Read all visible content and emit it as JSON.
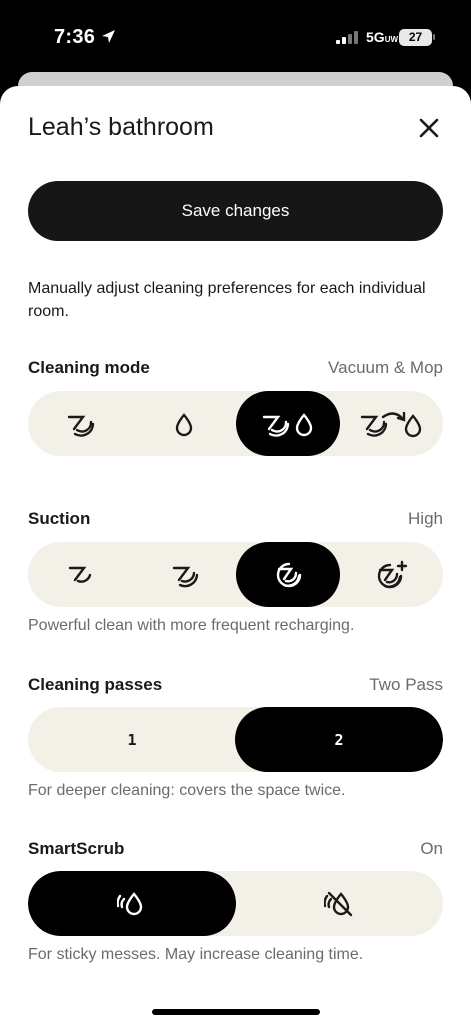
{
  "status_bar": {
    "time": "7:36",
    "network": "5G",
    "network_sub": "UW",
    "battery": "27"
  },
  "sheet": {
    "title": "Leah’s bathroom",
    "save_label": "Save changes",
    "description": "Manually adjust cleaning preferences for each individual room."
  },
  "cleaning_mode": {
    "label": "Cleaning mode",
    "value": "Vacuum & Mop",
    "options": [
      "vacuum-icon",
      "mop-icon",
      "vacuum-and-mop-icon",
      "vacuum-then-mop-icon"
    ],
    "selected_index": 2
  },
  "suction": {
    "label": "Suction",
    "value": "High",
    "help": "Powerful clean with more frequent recharging.",
    "options": [
      "suction-low-icon",
      "suction-medium-icon",
      "suction-high-icon",
      "suction-max-icon"
    ],
    "selected_index": 2
  },
  "passes": {
    "label": "Cleaning passes",
    "value": "Two Pass",
    "help": "For deeper cleaning: covers the space twice.",
    "options": [
      "1",
      "2"
    ],
    "selected_index": 1
  },
  "smartscrub": {
    "label": "SmartScrub",
    "value": "On",
    "help": "For sticky messes. May increase cleaning time.",
    "options": [
      "scrub-on-icon",
      "scrub-off-icon"
    ],
    "selected_index": 0
  }
}
